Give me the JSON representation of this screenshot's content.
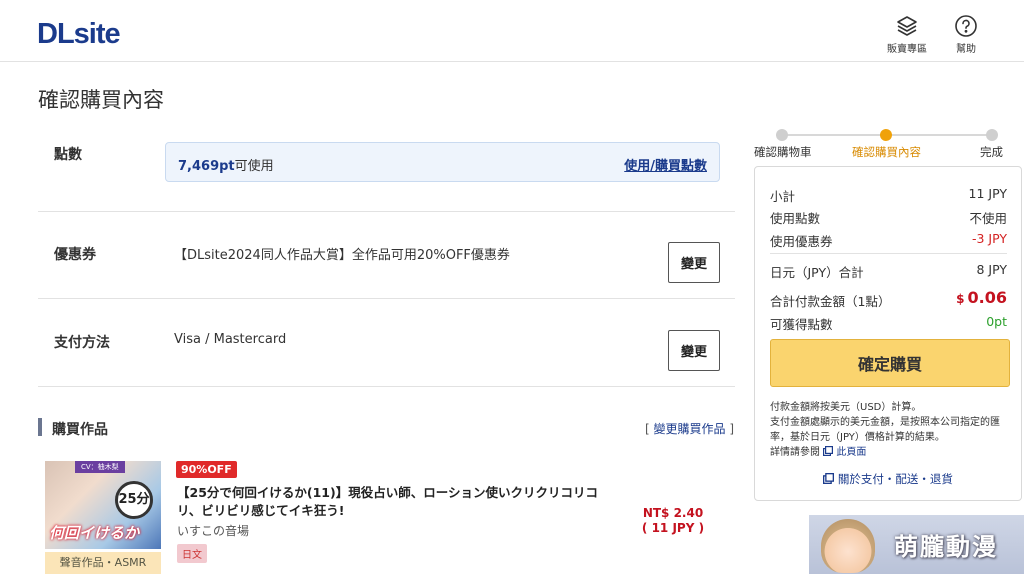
{
  "header": {
    "logo": "DLsite",
    "sell_label": "販賣專區",
    "help_label": "幫助"
  },
  "page_title": "確認購買內容",
  "points": {
    "label": "點數",
    "available_amount": "7,469pt",
    "available_suffix": "可使用",
    "use_link": "使用/購買點數"
  },
  "coupon": {
    "label": "優惠券",
    "value": "【DLsite2024同人作品大賞】全作品可用20%OFF優惠券",
    "change_label": "變更"
  },
  "payment": {
    "label": "支付方法",
    "value": "Visa / Mastercard",
    "change_label": "變更"
  },
  "works": {
    "section_title": "購買作品",
    "change_link_open": "[ ",
    "change_link": "變更購買作品",
    "change_link_close": " ]",
    "items": [
      {
        "thumb_cv": "CV：柚木梨",
        "thumb_timer": "25分",
        "thumb_caption": "何回イけるか",
        "genre": "聲音作品・ASMR",
        "discount": "90%OFF",
        "title": "【25分で何回イけるか(11)】現役占い師、ローション使いクリクリコリコリ、ビリビリ感じてイキ狂う!",
        "circle": "いすこの音場",
        "language": "日文",
        "price_ntd": "NT$ 2.40",
        "price_jpy": "( 11 JPY )"
      }
    ]
  },
  "steps": [
    {
      "label": "確認購物車",
      "active": false
    },
    {
      "label": "確認購買內容",
      "active": true
    },
    {
      "label": "完成",
      "active": false
    }
  ],
  "summary": {
    "subtotal_label": "小計",
    "subtotal_value": "11 JPY",
    "points_used_label": "使用點數",
    "points_used_value": "不使用",
    "coupon_used_label": "使用優惠券",
    "coupon_used_value": "-3 JPY",
    "jpy_total_label": "日元（JPY）合計",
    "jpy_total_value": "8 JPY",
    "pay_total_label": "合計付款金額（1點）",
    "pay_total_currency": "$",
    "pay_total_value": "0.06",
    "earn_points_label": "可獲得點數",
    "earn_points_value": "0pt",
    "confirm_button": "確定購買",
    "note_line1": "付款金額將按美元（USD）計算。",
    "note_line2": "支付金額處顯示的美元金額，是按照本公司指定的匯率，基於日元（JPY）價格計算的結果。",
    "note_line3_prefix": "詳情請參閱",
    "note_line3_link": "此頁面",
    "payment_link": "關於支付・配送・退貨"
  },
  "watermark": {
    "text": "萌朧動漫"
  },
  "colors": {
    "brand": "#1b3b8c",
    "accent": "#f0a20a",
    "price_red": "#c4121f",
    "confirm_yellow": "#fad46e"
  }
}
